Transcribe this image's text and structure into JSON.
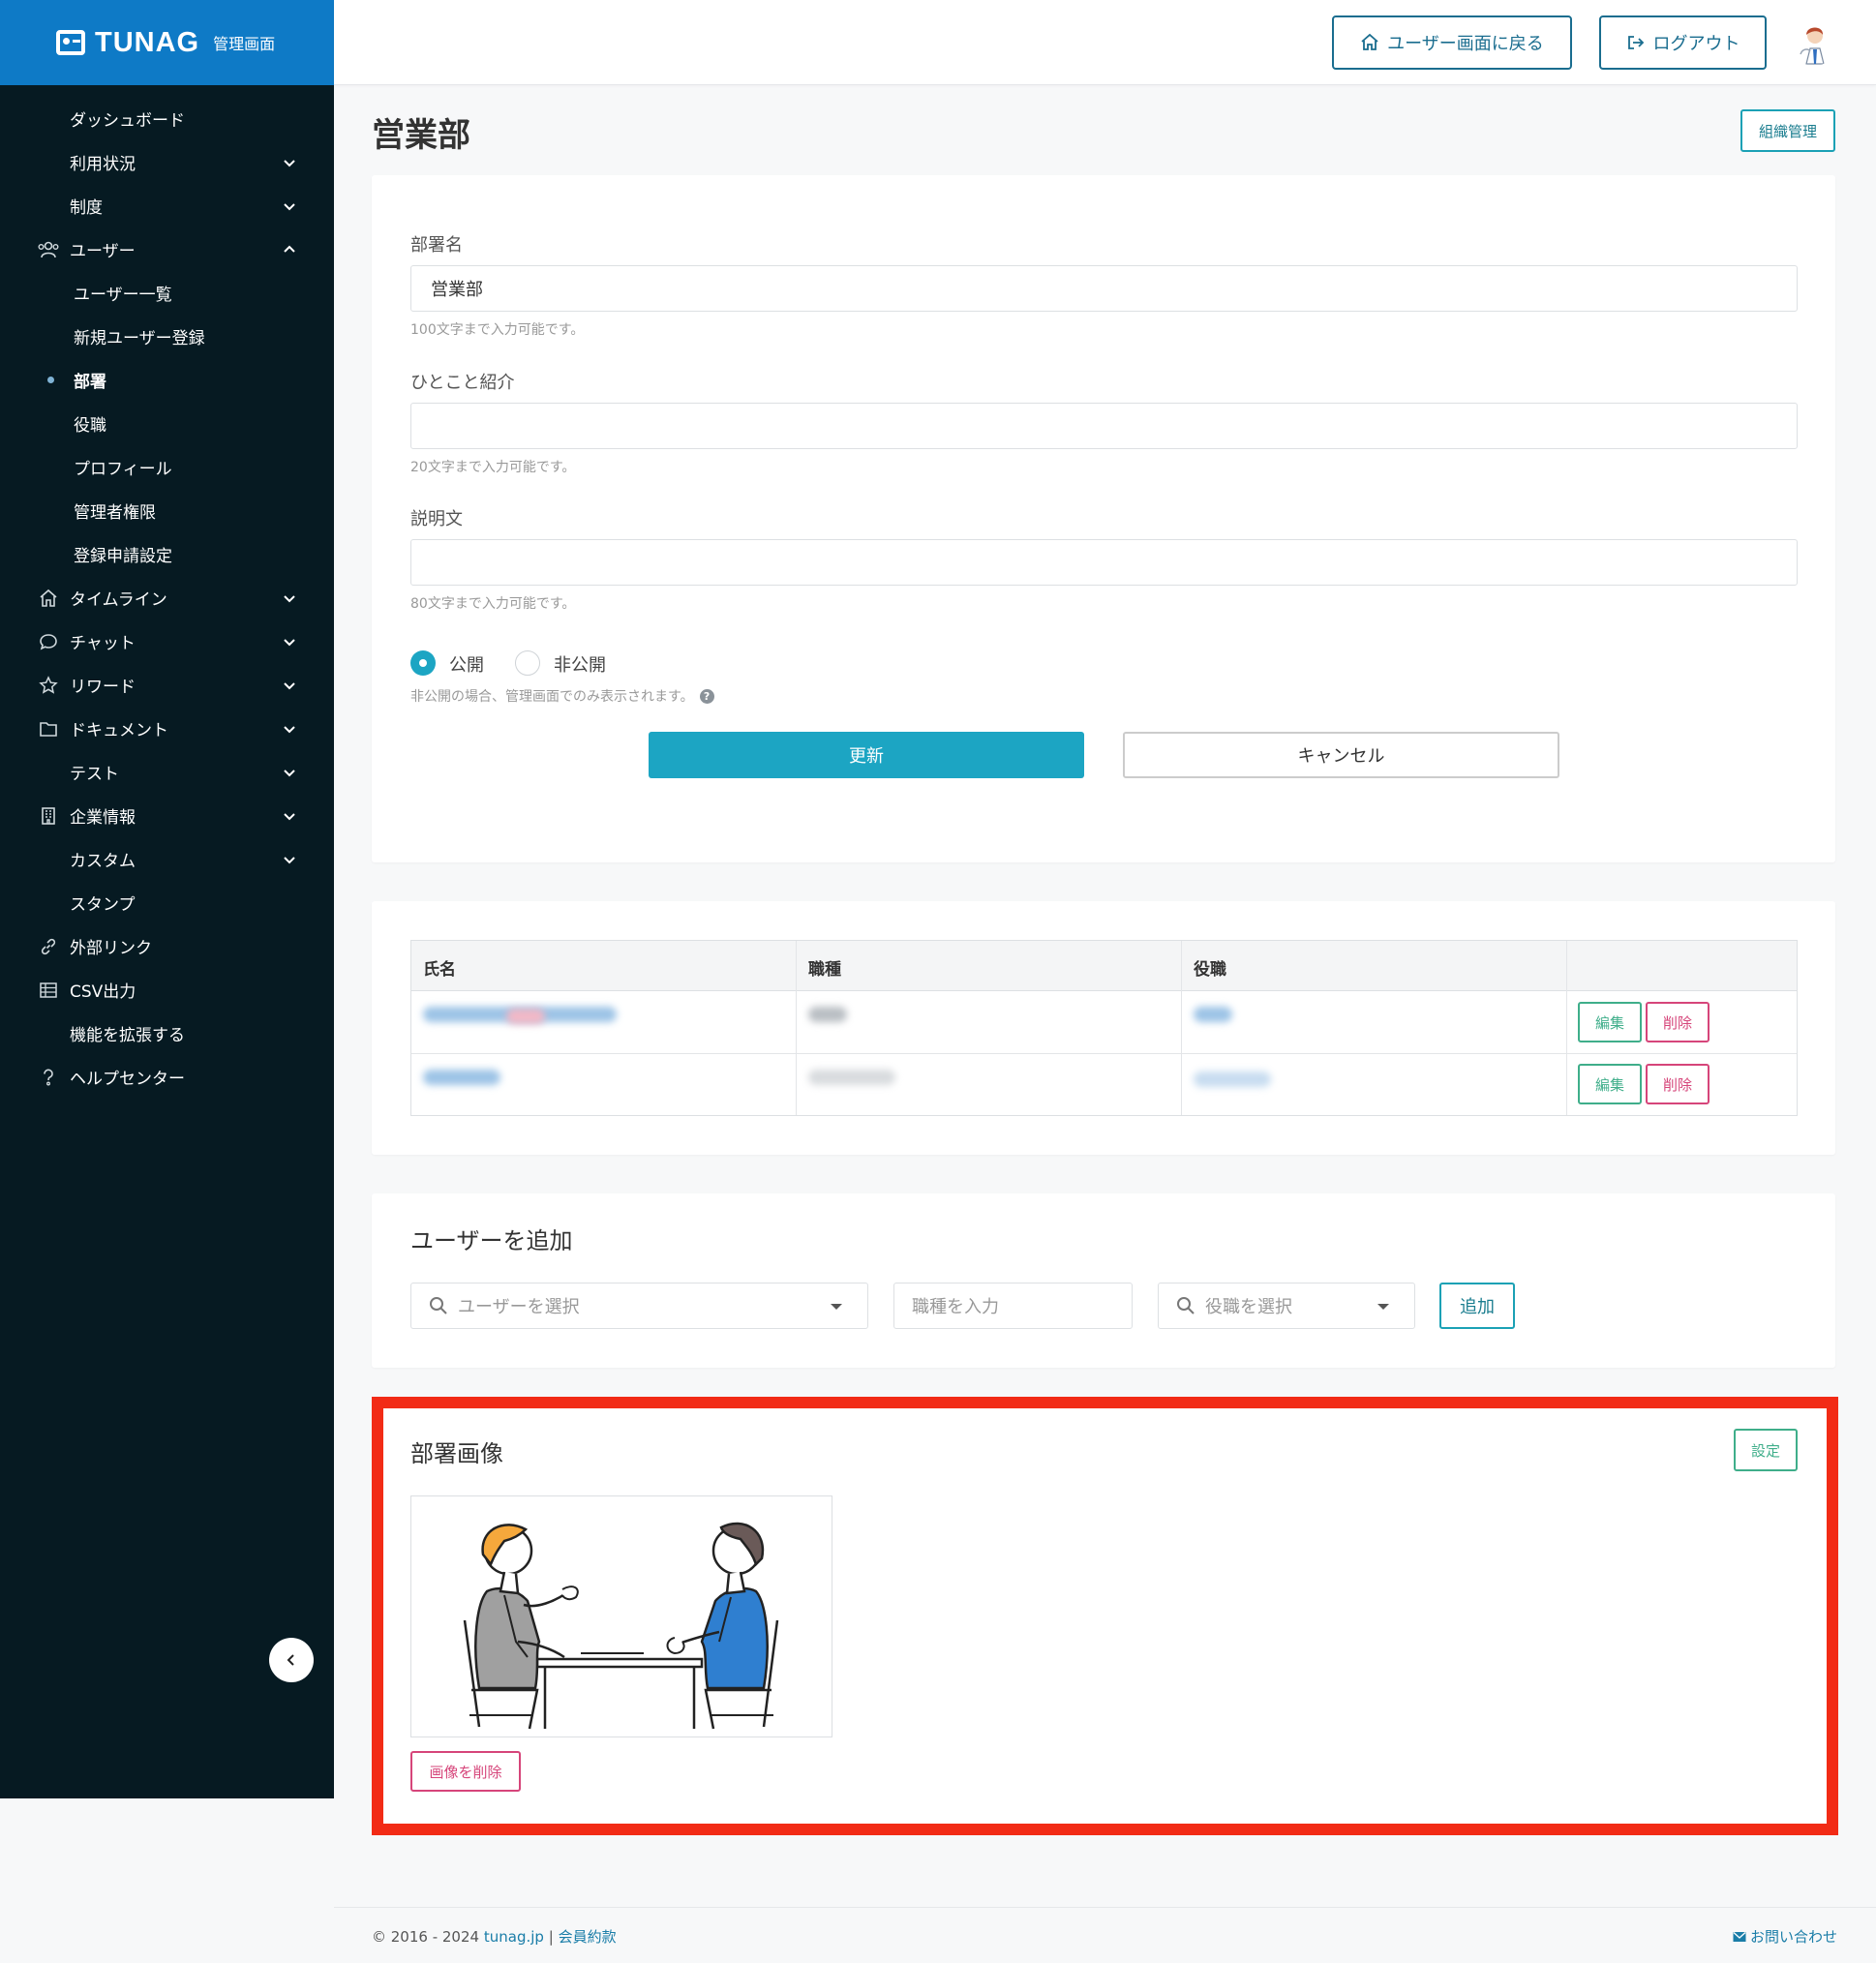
{
  "brand": {
    "name": "TUNAG",
    "sub": "管理画面"
  },
  "sidebar": {
    "items": [
      {
        "label": "ダッシュボード"
      },
      {
        "label": "利用状況"
      },
      {
        "label": "制度"
      },
      {
        "label": "ユーザー"
      },
      {
        "label": "ユーザー一覧"
      },
      {
        "label": "新規ユーザー登録"
      },
      {
        "label": "部署"
      },
      {
        "label": "役職"
      },
      {
        "label": "プロフィール"
      },
      {
        "label": "管理者権限"
      },
      {
        "label": "登録申請設定"
      },
      {
        "label": "タイムライン"
      },
      {
        "label": "チャット"
      },
      {
        "label": "リワード"
      },
      {
        "label": "ドキュメント"
      },
      {
        "label": "テスト"
      },
      {
        "label": "企業情報"
      },
      {
        "label": "カスタム"
      },
      {
        "label": "スタンプ"
      },
      {
        "label": "外部リンク"
      },
      {
        "label": "CSV出力"
      },
      {
        "label": "機能を拡張する"
      },
      {
        "label": "ヘルプセンター"
      }
    ]
  },
  "header": {
    "back_label": "ユーザー画面に戻る",
    "logout_label": "ログアウト"
  },
  "page": {
    "title": "営業部",
    "org_button": "組織管理"
  },
  "form": {
    "name_label": "部署名",
    "name_value": "営業部",
    "name_hint": "100文字まで入力可能です。",
    "intro_label": "ひとこと紹介",
    "intro_value": "",
    "intro_hint": "20文字まで入力可能です。",
    "desc_label": "説明文",
    "desc_value": "",
    "desc_hint": "80文字まで入力可能です。",
    "public_label": "公開",
    "private_label": "非公開",
    "visibility_hint": "非公開の場合、管理画面でのみ表示されます。",
    "update_label": "更新",
    "cancel_label": "キャンセル"
  },
  "members": {
    "headers": [
      "氏名",
      "職種",
      "役職",
      ""
    ],
    "edit_label": "編集",
    "delete_label": "削除"
  },
  "add_user": {
    "title": "ユーザーを追加",
    "user_placeholder": "ユーザーを選択",
    "job_placeholder": "職種を入力",
    "position_placeholder": "役職を選択",
    "add_label": "追加"
  },
  "dept_image": {
    "title": "部署画像",
    "set_label": "設定",
    "delete_label": "画像を削除"
  },
  "footer": {
    "copyright": "© 2016 - 2024",
    "site": "tunag.jp",
    "separator": "|",
    "terms": "会員約款",
    "contact": "お問い合わせ"
  },
  "colors": {
    "sidebar_bg": "#061a22",
    "brand_bg": "#0e7ac6",
    "primary": "#1ca5c3",
    "edit": "#3fae8a",
    "delete": "#d6457a",
    "highlight": "#f22b16"
  }
}
